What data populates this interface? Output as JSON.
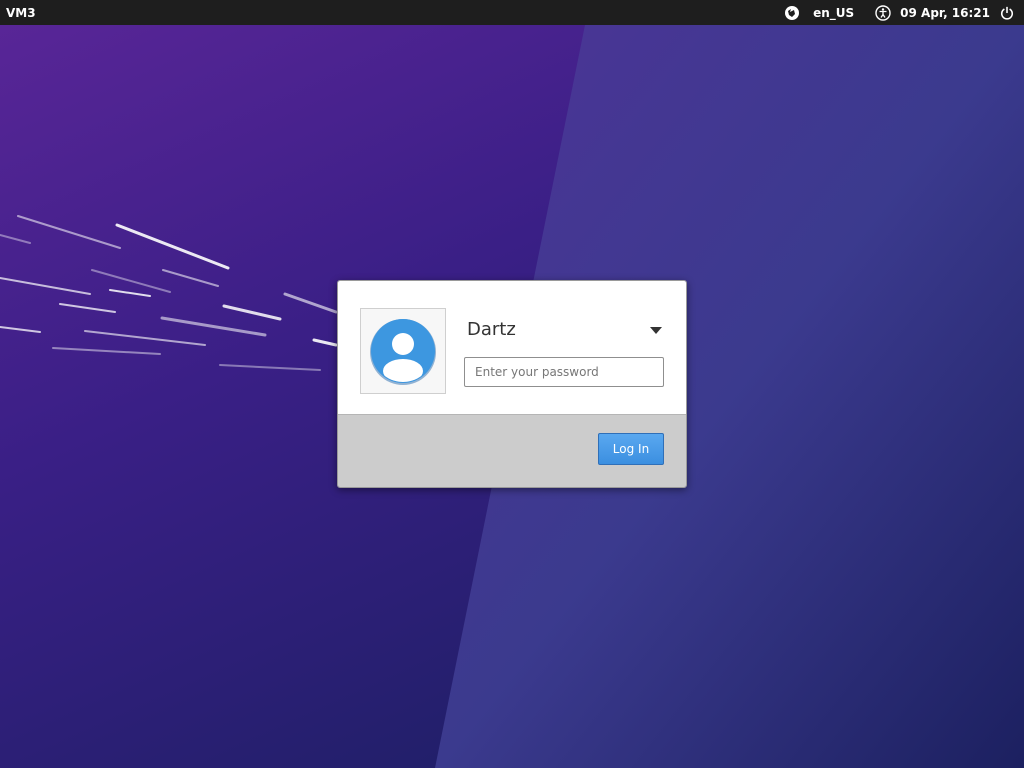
{
  "top_panel": {
    "host_name": "VM3",
    "keyboard_layout": "en_US",
    "datetime": "09 Apr, 16:21",
    "icons": [
      "session-indicator-icon",
      "accessibility-icon",
      "power-icon"
    ]
  },
  "login": {
    "user_name": "Dartz",
    "password": {
      "value": "",
      "placeholder": "Enter your password"
    },
    "login_button_label": "Log In",
    "avatar_icon": "user-avatar-icon",
    "dropdown_icon": "triangle-down-icon"
  },
  "colors": {
    "panel_bg": "#1e1e1e",
    "button_blue": "#3b8fe0",
    "wallpaper_purple": "#4a2490"
  }
}
